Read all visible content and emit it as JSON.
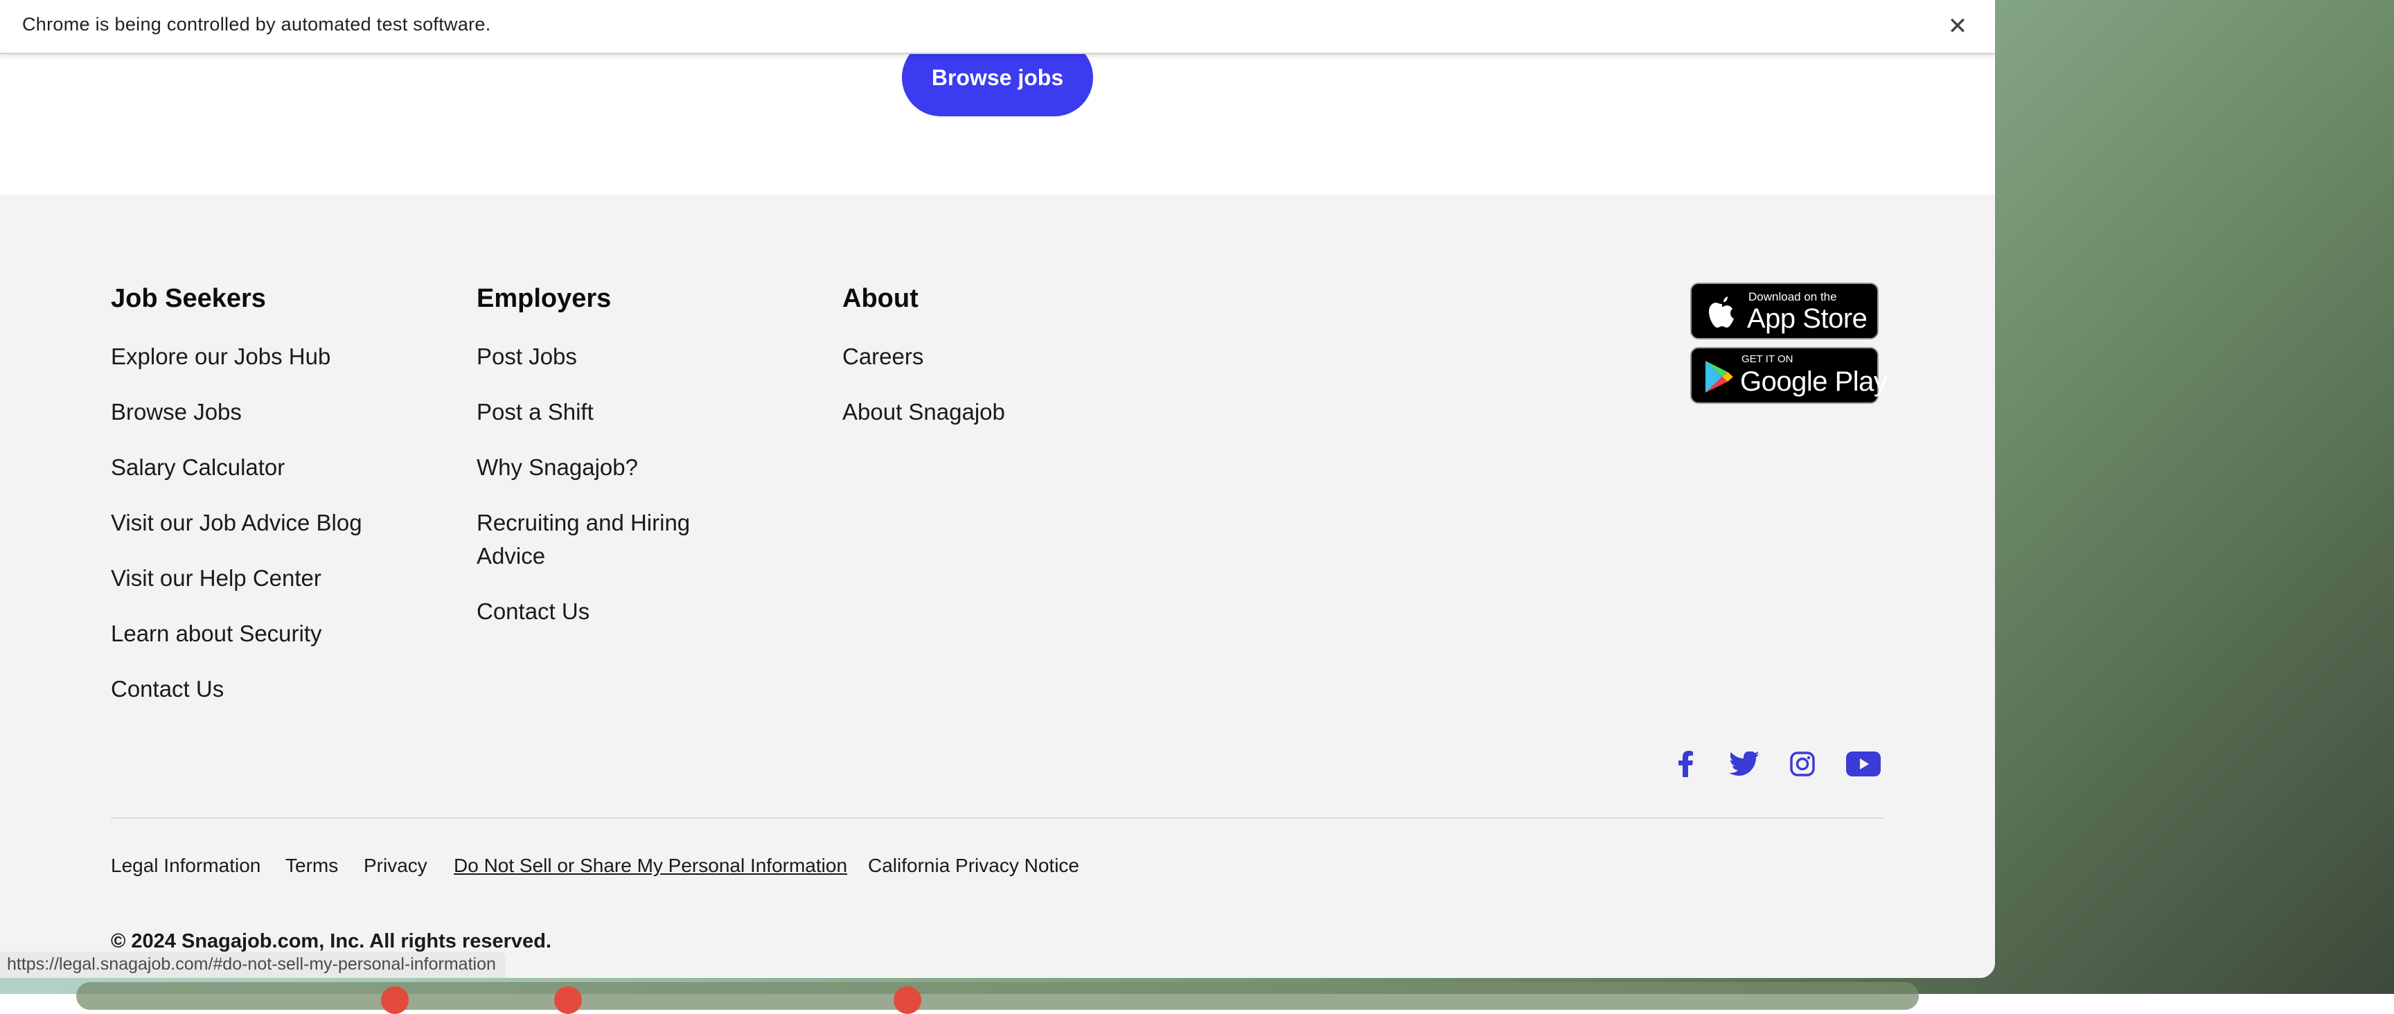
{
  "infobar": {
    "message": "Chrome is being controlled by automated test software.",
    "close_glyph": "✕"
  },
  "hero": {
    "button_label": "Browse jobs"
  },
  "footer": {
    "job_seekers": {
      "title": "Job Seekers",
      "links": [
        "Explore our Jobs Hub",
        "Browse Jobs",
        "Salary Calculator",
        "Visit our Job Advice Blog",
        "Visit our Help Center",
        "Learn about Security",
        "Contact Us"
      ]
    },
    "employers": {
      "title": "Employers",
      "links": [
        "Post Jobs",
        "Post a Shift",
        "Why Snagajob?",
        "Recruiting and Hiring Advice",
        "Contact Us"
      ]
    },
    "about": {
      "title": "About",
      "links": [
        "Careers",
        "About Snagajob"
      ]
    },
    "app_store": {
      "small": "Download on the",
      "big": "App Store"
    },
    "google_play": {
      "small": "GET IT ON",
      "big": "Google Play"
    },
    "social_icons": [
      "facebook-icon",
      "twitter-icon",
      "instagram-icon",
      "youtube-icon"
    ],
    "legal_links": [
      "Legal Information",
      "Terms",
      "Privacy",
      "Do Not Sell or Share My Personal Information",
      "California Privacy Notice"
    ],
    "copyright": "© 2024 Snagajob.com, Inc. All rights reserved."
  },
  "status_bar": {
    "url": "https://legal.snagajob.com/#do-not-sell-my-personal-information"
  },
  "colors": {
    "accent": "#3b3bf0",
    "footer_bg": "#f3f3f3",
    "social": "#3b3bd6"
  }
}
